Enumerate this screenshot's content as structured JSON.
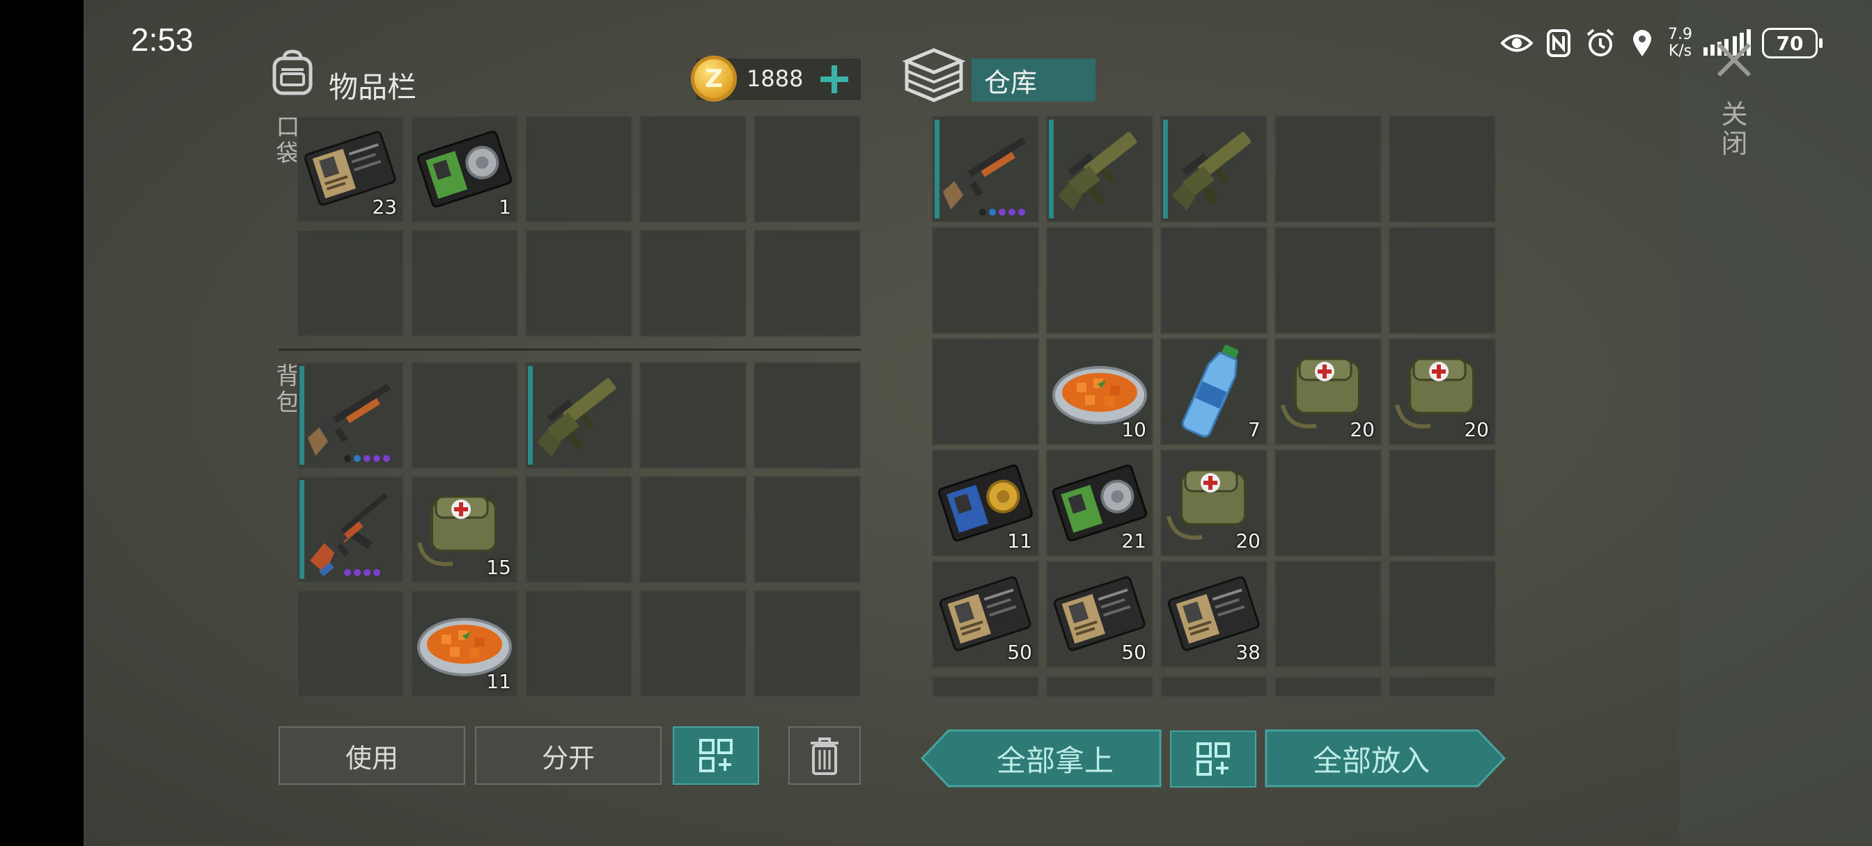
{
  "status_bar": {
    "time": "2:53",
    "net_speed_value": "7.9",
    "net_speed_unit": "K/s",
    "battery": "70"
  },
  "inventory": {
    "title": "物品栏",
    "currency_amount": "1888",
    "currency_icon": "z-coin-icon",
    "pocket_label": "口袋",
    "backpack_label": "背包",
    "pocket_slots": [
      {
        "item": "patrol-id-card-icon",
        "qty": "23"
      },
      {
        "item": "police-badge-id-icon",
        "qty": "1"
      },
      null,
      null,
      null,
      null,
      null,
      null,
      null,
      null
    ],
    "backpack_slots": [
      {
        "item": "shotgun-icon",
        "qty": "",
        "rarity_dots": 5
      },
      null,
      {
        "item": "grenade-launcher-icon",
        "qty": ""
      },
      null,
      null,
      {
        "item": "ak-rifle-icon",
        "qty": "",
        "rarity_dots": 4
      },
      {
        "item": "medical-bag-icon",
        "qty": "15"
      },
      null,
      null,
      null,
      null,
      {
        "item": "carrot-stew-icon",
        "qty": "11"
      },
      null,
      null,
      null
    ],
    "buttons": {
      "use": "使用",
      "split": "分开"
    }
  },
  "storage": {
    "title": "仓库",
    "slots": [
      {
        "item": "shotgun-icon",
        "qty": "",
        "rarity_dots": 5
      },
      {
        "item": "grenade-launcher-icon",
        "qty": ""
      },
      {
        "item": "grenade-launcher-icon",
        "qty": ""
      },
      null,
      null,
      null,
      null,
      null,
      null,
      null,
      null,
      {
        "item": "carrot-stew-icon",
        "qty": "10"
      },
      {
        "item": "water-bottle-icon",
        "qty": "7"
      },
      {
        "item": "medical-bag-icon",
        "qty": "20"
      },
      {
        "item": "medical-bag-icon",
        "qty": "20"
      },
      {
        "item": "gold-badge-id-icon",
        "qty": "11"
      },
      {
        "item": "police-badge-id-icon",
        "qty": "21"
      },
      {
        "item": "medical-bag-icon",
        "qty": "20"
      },
      null,
      null,
      {
        "item": "patrol-id-card-icon",
        "qty": "50"
      },
      {
        "item": "patrol-id-card-icon",
        "qty": "50"
      },
      {
        "item": "patrol-id-card-icon",
        "qty": "38"
      },
      null,
      null
    ],
    "buttons": {
      "take_all": "全部拿上",
      "store_all": "全部放入"
    }
  },
  "close_label": "关闭",
  "colors": {
    "accent_teal": "#2d7a77",
    "cell_bg": "#393c37",
    "rarity_purple": "#7d3fd0"
  }
}
